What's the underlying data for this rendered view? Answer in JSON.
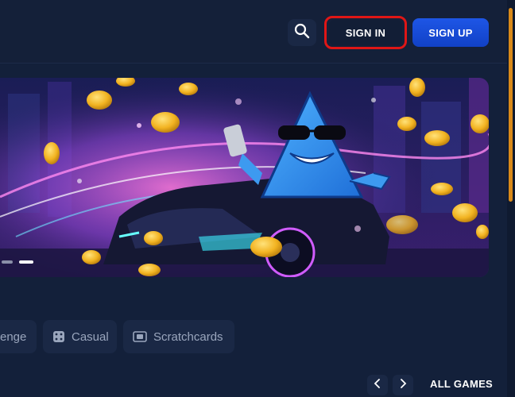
{
  "header": {
    "search_icon": "search-icon",
    "sign_in_label": "SIGN IN",
    "sign_up_label": "SIGN UP",
    "highlight_color": "#e01616",
    "sign_up_color": "#1e56e6"
  },
  "banner": {
    "slide_count": 2,
    "active_slide": 2
  },
  "categories": [
    {
      "label": "enge",
      "icon": "none"
    },
    {
      "label": "Casual",
      "icon": "dice-icon"
    },
    {
      "label": "Scratchcards",
      "icon": "scratchcard-icon"
    }
  ],
  "games_nav": {
    "prev_icon": "chevron-left-icon",
    "next_icon": "chevron-right-icon",
    "all_games_label": "ALL GAMES"
  },
  "colors": {
    "background": "#13203a",
    "scroll_thumb": "#d98a1a",
    "chip_bg": "#1a2845",
    "chip_text": "#9aa6bd"
  }
}
